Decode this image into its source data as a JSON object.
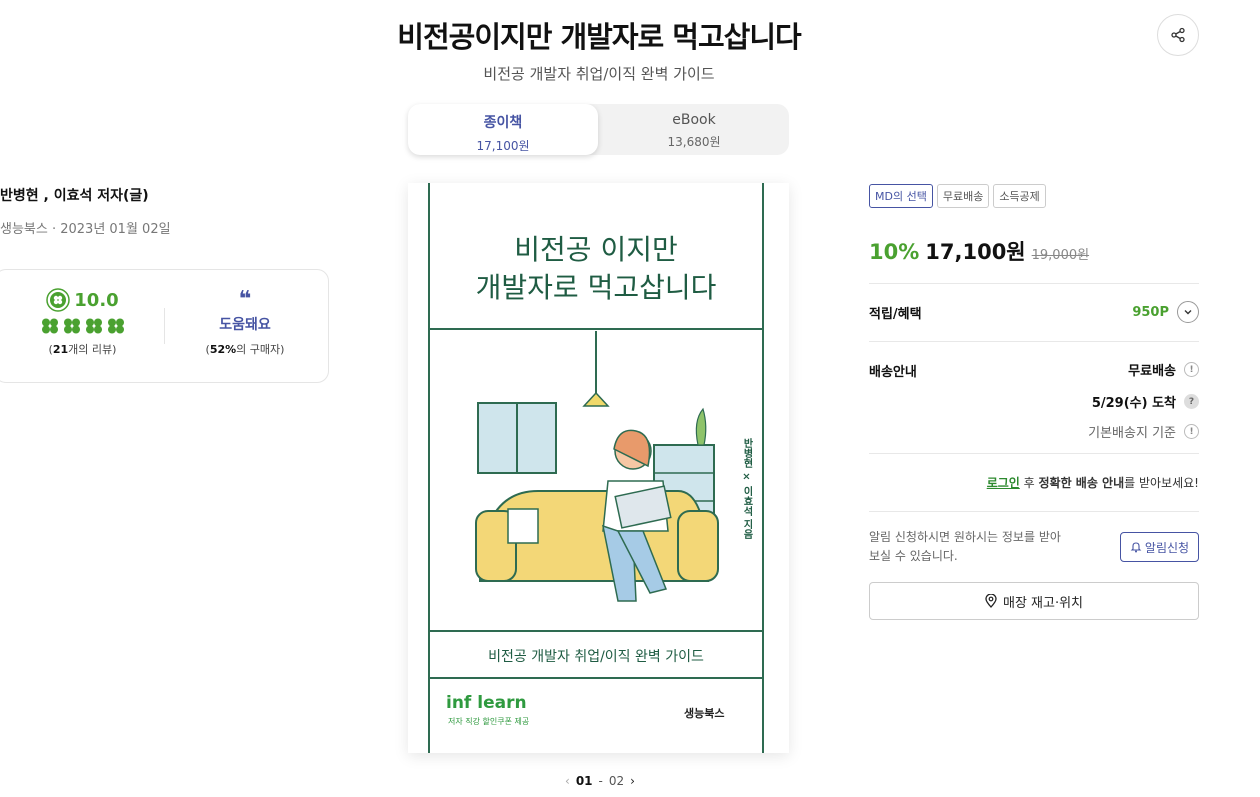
{
  "header": {
    "title": "비전공이지만 개발자로 먹고삽니다",
    "subtitle": "비전공 개발자 취업/이직 완벽 가이드"
  },
  "format_tabs": [
    {
      "name": "종이책",
      "price": "17,100원",
      "active": true
    },
    {
      "name": "eBook",
      "price": "13,680원",
      "active": false
    }
  ],
  "book_info": {
    "authors": "반병현 , 이효석 저자(글)",
    "publisher_date": "생능북스 · 2023년 01월 02일"
  },
  "review": {
    "score": "10.0",
    "review_count": "21",
    "review_count_suffix": "개의 리뷰)",
    "review_count_prefix": "(",
    "quote_mark": "❝",
    "helpful_label": "도움돼요",
    "helpful_pct": "52%",
    "helpful_suffix": "의 구매자)",
    "helpful_prefix": "(",
    "clover_count": 4,
    "colors": {
      "green": "#4aa130",
      "navy": "#4654a3"
    }
  },
  "cover": {
    "title_line1": "비전공 이지만",
    "title_line2": "개발자로 먹고삽니다",
    "vertical_text": "반병현 × 이효석 지음",
    "subtitle": "비전공 개발자 취업/이직 완벽 가이드",
    "logo": "inf learn",
    "logo_sub": "저자 직강 할인쿠폰 제공",
    "publisher": "생능북스",
    "colors": {
      "line": "#2e6b51",
      "logo": "#2f9a3f"
    }
  },
  "pager": {
    "current": "01",
    "separator": "-",
    "total": "02"
  },
  "badges": [
    "MD의 선택",
    "무료배송",
    "소득공제"
  ],
  "price": {
    "discount": "10%",
    "sale": "17,100원",
    "original": "19,000원"
  },
  "benefits": {
    "label": "적립/혜택",
    "points": "950P"
  },
  "shipping": {
    "label": "배송안내",
    "type": "무료배송",
    "arrival": "5/29(수) 도착",
    "basis": "기본배송지 기준",
    "login_link": "로그인",
    "login_mid": " 후 ",
    "login_bold": "정확한 배송 안내",
    "login_tail": "를 받아보세요!"
  },
  "notification": {
    "text": "알림 신청하시면 원하시는 정보를 받아 보실 수 있습니다.",
    "button": "알림신청"
  },
  "store": {
    "button": "매장 재고·위치"
  }
}
